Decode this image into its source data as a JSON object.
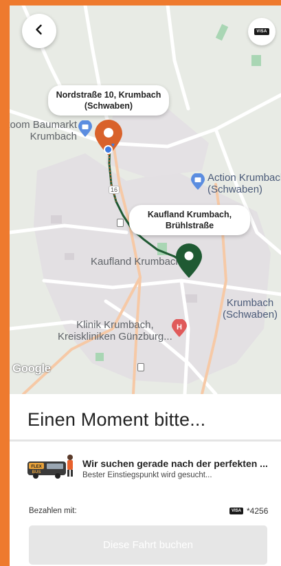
{
  "header": {
    "back_icon": "chevron-left-icon",
    "payment_badge": "VISA"
  },
  "map": {
    "origin_bubble": "Nordstraße 10, Krumbach (Schwaben)",
    "destination_bubble": "Kaufland Krumbach, Brühlstraße",
    "labels": {
      "toom": "toom Baumarkt\nKrumbach",
      "action": "Action Krumbach\n(Schwaben)",
      "kaufland": "Kaufland Krumbach",
      "krumbach": "Krumbach\n(Schwaben)",
      "klinik": "Klinik Krumbach,\nKreiskliniken Günzburg...",
      "road_number": "16"
    },
    "attribution": "Google",
    "colors": {
      "origin_pin": "#d9622b",
      "destination_pin": "#1f5a33",
      "route": "#1f5a33"
    }
  },
  "sheet": {
    "title": "Einen Moment bitte...",
    "status_title": "Wir suchen gerade nach der perfekten ...",
    "status_subtitle": "Bester Einstiegspunkt wird gesucht...",
    "bus_brand": "FLEX BUS",
    "payment_label": "Bezahlen mit:",
    "payment_card_brand": "VISA",
    "payment_card_number": "*4256",
    "book_button": "Diese Fahrt buchen"
  },
  "colors": {
    "border": "#ee7a2e",
    "button_disabled": "#e6e6e6"
  }
}
